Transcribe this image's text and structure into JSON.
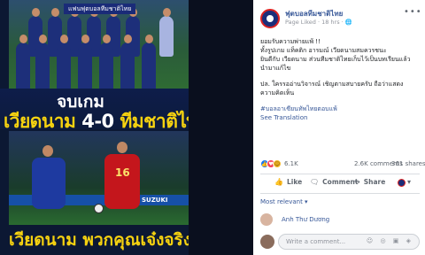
{
  "image": {
    "watermark": "แฟนฟุตบอลทีมชาติไทย",
    "headline_end": "จบเกม",
    "headline_vn": "เวียดนาม",
    "headline_score": "4-0",
    "headline_th": "ทีมชาติไทย",
    "headline_bottom": "เวียดนาม พวกคุณเจ๋งจริง",
    "player_number": "16",
    "ad_board": "SUZUKI"
  },
  "post": {
    "page_name": "ฟุตบอลทีมชาติไทย",
    "meta": "Page Liked · 18 hrs · 🌐",
    "body_lines": [
      "ยอมรับความพ่ายแพ้ !!",
      "ทั้งรูปเกม แท็คติก อารมณ์ เวียดนามสมควรชนะ",
      "ยินดีกับ เวียดนาม ส่วนทีมชาติไทยเก็บไว้เป็นบทเรียนแล้ว",
      "นำมาแก้ไข",
      "",
      "ปล. ใครรออ่านวิจารณ์ เชิญตามสบายครับ ถือว่าแสดง",
      "ความคิดเห็น"
    ],
    "hashtag": "#บอลอาเซียนทัพไทยตอบแพ้",
    "see_translation": "See Translation",
    "reaction_count": "6.1K",
    "comments_count": "2.6K comments",
    "shares_count": "361 shares",
    "actions": {
      "like": "Like",
      "comment": "Comment",
      "share": "Share"
    },
    "most_relevant": "Most relevant ▾",
    "commenter_name": "Anh Thư Dương",
    "comment_placeholder": "Write a comment...",
    "comment_icons": "☺ ◎ ▣ ◈"
  },
  "colors": {
    "link": "#385898",
    "headline_yellow": "#f6d210",
    "like_blue": "#1877f2"
  },
  "icons": {
    "like": "thumbs-up-icon",
    "comment": "comment-icon",
    "share": "share-icon",
    "more": "more-options-icon",
    "globe": "globe-icon"
  }
}
